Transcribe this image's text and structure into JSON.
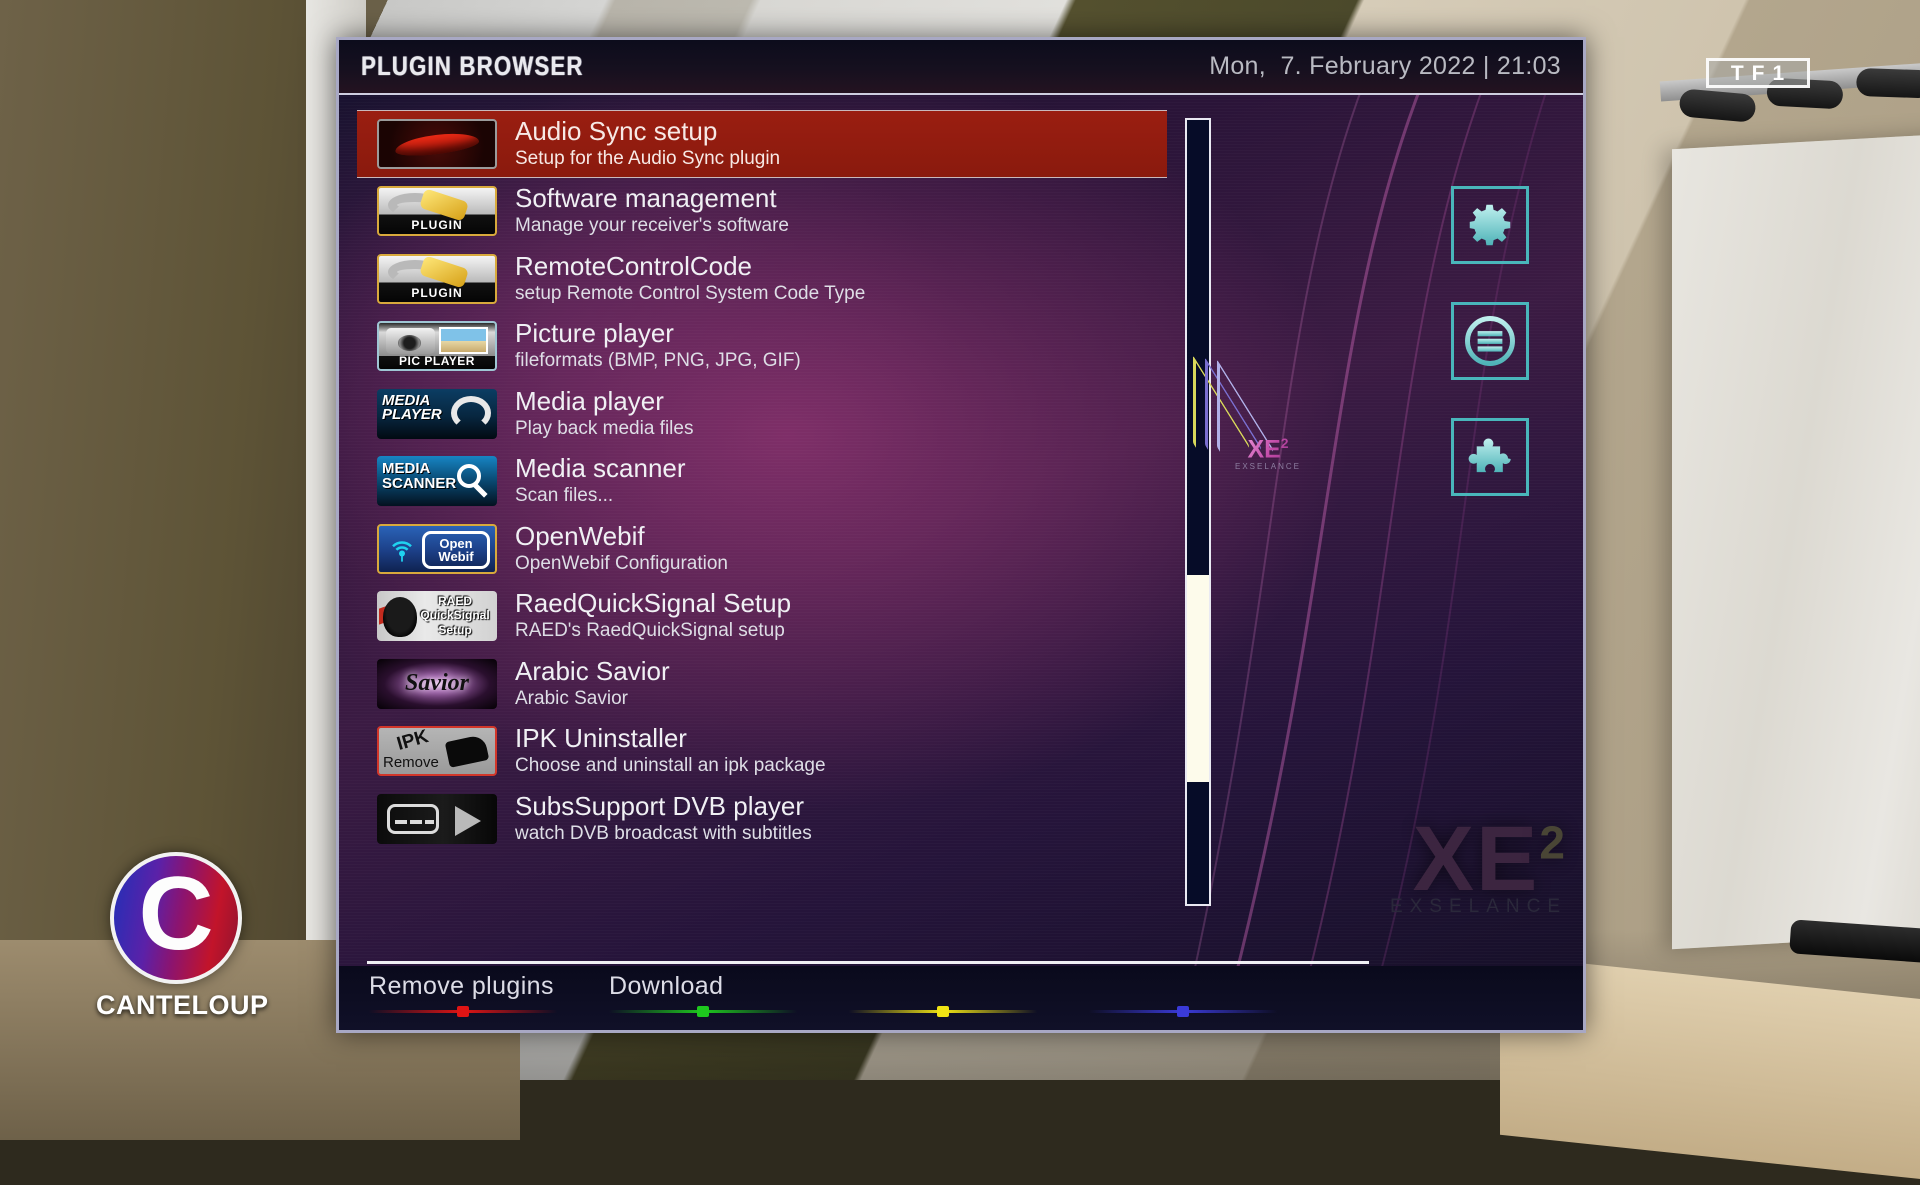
{
  "broadcast": {
    "channel_logo": [
      "T",
      "F",
      "1"
    ],
    "bug_letter": "C",
    "bug_name": "CANTELOUP"
  },
  "header": {
    "title": "PLUGIN BROWSER",
    "datetime": "Mon,  7. February 2022 | 21:03"
  },
  "theme": {
    "accent_teal": "#49b6bb",
    "selection_red": "#9a1e11",
    "panel_border": "#a8a8c4",
    "scrollbar_thumb": "#fdfbeb",
    "scrollbar_track": "#060c28"
  },
  "plugins": [
    {
      "name": "Audio Sync setup",
      "desc": "Setup for the Audio Sync plugin",
      "icon": "audio-sync-icon",
      "selected": true
    },
    {
      "name": "Software management",
      "desc": "Manage your receiver's software",
      "icon": "plugin-icon",
      "selected": false
    },
    {
      "name": "RemoteControlCode",
      "desc": "setup Remote Control System Code Type",
      "icon": "plugin-icon",
      "selected": false
    },
    {
      "name": "Picture player",
      "desc": "fileformats (BMP, PNG, JPG, GIF)",
      "icon": "pic-player-icon",
      "selected": false
    },
    {
      "name": "Media player",
      "desc": "Play back media files",
      "icon": "media-player-icon",
      "selected": false
    },
    {
      "name": "Media scanner",
      "desc": "Scan files...",
      "icon": "media-scanner-icon",
      "selected": false
    },
    {
      "name": "OpenWebif",
      "desc": "OpenWebif Configuration",
      "icon": "openwebif-icon",
      "selected": false
    },
    {
      "name": "RaedQuickSignal Setup",
      "desc": "RAED's RaedQuickSignal setup",
      "icon": "raed-quicksignal-icon",
      "selected": false
    },
    {
      "name": "Arabic Savior",
      "desc": "Arabic Savior",
      "icon": "savior-icon",
      "selected": false
    },
    {
      "name": "IPK Uninstaller",
      "desc": "Choose and uninstall an ipk package",
      "icon": "ipk-remove-icon",
      "selected": false
    },
    {
      "name": "SubsSupport DVB player",
      "desc": "watch DVB broadcast with subtitles",
      "icon": "subs-dvb-icon",
      "selected": false
    }
  ],
  "thumb_labels": {
    "plugin": "PLUGIN",
    "pic_player": "PIC PLAYER",
    "media_player_1": "MEDIA",
    "media_player_2": "PLAYER",
    "media_scanner_1": "MEDIA",
    "media_scanner_2": "SCANNER",
    "openwebif_1": "Open",
    "openwebif_2": "Webif",
    "raed_1": "RAED",
    "raed_2": "QuickSignal",
    "raed_3": "Setup",
    "savior": "Savior",
    "ipk_1": "IPK",
    "ipk_2": "Remove"
  },
  "scrollbar": {
    "thumb_top_pct": 58.0,
    "thumb_height_pct": 26.5
  },
  "side_icons": [
    {
      "name": "gear-icon",
      "label": "Setup"
    },
    {
      "name": "menu-icon",
      "label": "Main menu"
    },
    {
      "name": "puzzle-icon",
      "label": "Plugins"
    }
  ],
  "branding": {
    "xe_main": "XE",
    "xe_sup": "2",
    "xe_sub": "EXSELANCE"
  },
  "footer": {
    "buttons": [
      {
        "label": "Remove plugins",
        "color": "#e01414"
      },
      {
        "label": "Download",
        "color": "#1ec81e"
      },
      {
        "label": "",
        "color": "#f0e414"
      },
      {
        "label": "",
        "color": "#3a3ad8"
      }
    ]
  }
}
